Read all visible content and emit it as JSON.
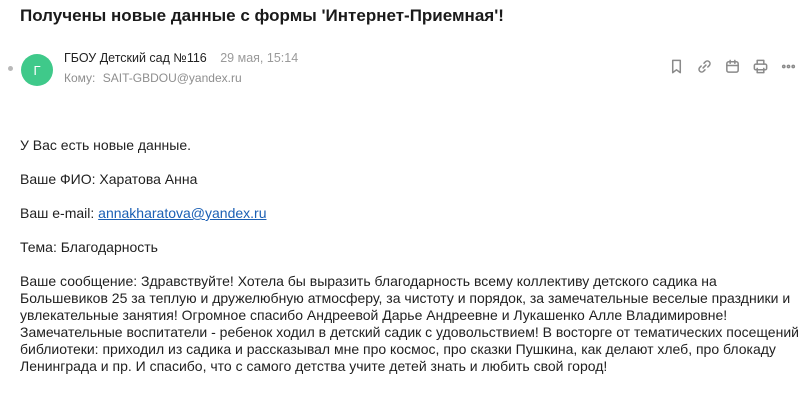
{
  "email": {
    "subject": "Получены новые данные с формы 'Интернет-Приемная'!",
    "sender": {
      "initial": "Г",
      "name": "ГБОУ Детский сад №116",
      "date": "29 мая, 15:14",
      "avatar_color": "#3fc98a"
    },
    "to": {
      "label": "Кому:",
      "address": "SAIT-GBDOU@yandex.ru"
    },
    "toolbar": [
      {
        "icon": "bookmark-icon"
      },
      {
        "icon": "link-icon"
      },
      {
        "icon": "calendar-icon"
      },
      {
        "icon": "print-icon"
      },
      {
        "icon": "more-icon"
      }
    ],
    "body": {
      "intro": "У Вас есть новые данные.",
      "name_line": "Ваше ФИО: Харатова Анна",
      "email_label": "Ваш e-mail:",
      "email_value": "annakharatova@yandex.ru",
      "topic_line": "Тема: Благодарность",
      "message": "Ваше сообщение: Здравствуйте! Хотела бы выразить благодарность всему коллективу детского садика на Большевиков 25 за теплую и дружелюбную атмосферу, за чистоту и порядок, за замечательные веселые праздники и увлекательные занятия! Огромное спасибо Андреевой Дарье Андреевне и Лукашенко Алле Владимировне! Замечательные воспитатели - ребенок ходил в детский садик с удовольствием! В восторге от тематических посещений библиотеки: приходил из садика и рассказывал мне про космос, про сказки Пушкина, как делают хлеб, про блокаду Ленинграда и пр. И спасибо, что с самого детства учите детей знать и любить свой город!"
    }
  }
}
